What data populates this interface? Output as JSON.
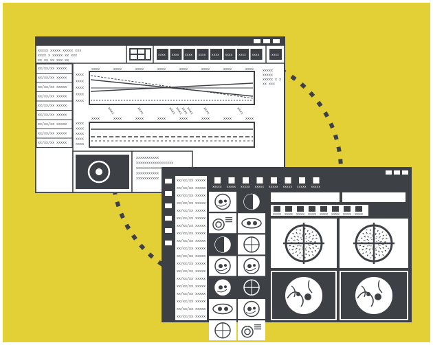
{
  "colors": {
    "background": "#e3cf36",
    "ink": "#3d4145",
    "paper": "#ffffff"
  },
  "icons": [
    "window-control-icons",
    "grid-layout-icon",
    "circle-scan-icon",
    "target-scan-icon",
    "brain-scan-icon",
    "spine-scan-icon",
    "document-icon"
  ],
  "window_back": {
    "header_text": [
      "xxxxx xxxxx   xxxxx xxx",
      "xxxx x xxxxx  xx   xxx",
      "xx  xx  xx      xxx  xx"
    ],
    "toolbar_tabs": [
      "xxxx",
      "xxxx",
      "xxxx",
      "xxxx",
      "xxxx",
      "xxxx",
      "xxxx",
      "xxxx"
    ],
    "toolbar_right": "xxxx",
    "list_items": [
      "xx/xx/xx xxxxx",
      "xx/xx/xx xxxxx",
      "xx/xx/xx xxxxx",
      "xx/xx/xx xxxxx",
      "xx/xx/xx xxxxx",
      "xx/xx/xx xxxxx",
      "xx/xx/xx xxxxx",
      "xx/xx/xx xxxxx",
      "xx/xx/xx xxxxx"
    ],
    "chart1": {
      "top_labels": [
        "xxxx",
        "xxxx",
        "xxxx",
        "xxxx",
        "xxxx",
        "xxxx",
        "xxxx",
        "xxxx"
      ],
      "left_labels": [
        "xxxx",
        "xxxx",
        "xxxx",
        "xxxx",
        "xxxx"
      ],
      "bottom_labels": [
        "xxxx",
        "xxxx",
        "xxxx",
        "xxxx",
        "xxxx",
        "xxxx",
        "xxxx",
        "xxxx"
      ],
      "rotated_labels": [
        "xxxx",
        "xxxx",
        "xxxx",
        "xxxx",
        "xxxx",
        "xxxx",
        "xxxx",
        "xxxx"
      ]
    },
    "chart2": {
      "left_labels": [
        "xxxx",
        "xxxx",
        "xxxx",
        "xxxx",
        "xxxx"
      ]
    },
    "side_note": [
      "xxxxx",
      "xxxxx",
      "xxxxx x x",
      "xx xxx"
    ],
    "text_block": [
      "xxxxxxxxxxx",
      "xxxxxxxxxxxxxxxxxx",
      "xxxxxxxxxxxxxxxxx",
      "xxxxxxxxxxx",
      "xxxxxxxxxxx"
    ]
  },
  "window_front": {
    "top_labels": [
      "xxxxx",
      "xxxxx",
      "xxxxx",
      "xxxxx",
      "xxxxx",
      "xxxxx",
      "xxxxx",
      "xxxxx"
    ],
    "list_items": [
      "xx/xx/xx xxxxx",
      "xx/xx/xx xxxxx",
      "xx/xx/xx xxxxx",
      "xx/xx/xx xxxxx",
      "xx/xx/xx xxxxx",
      "xx/xx/xx xxxxx",
      "xx/xx/xx xxxxx",
      "xx/xx/xx xxxxx",
      "xx/xx/xx xxxxx",
      "xx/xx/xx xxxxx",
      "xx/xx/xx xxxxx",
      "xx/xx/xx xxxxx",
      "xx/xx/xx xxxxx",
      "xx/xx/xx xxxxx",
      "xx/xx/xx xxxxx",
      "xx/xx/xx xxxxx",
      "xx/xx/xx xxxxx",
      "xx/xx/xx xxxxx",
      "xx/xx/xx xxxxx"
    ],
    "small_labels": [
      "xxxx",
      "xxxx",
      "xxxx",
      "xxxx",
      "xxxx",
      "xxxx",
      "xxxx",
      "xxxx"
    ],
    "side_labels": [
      "xxxx",
      "xxxx",
      "xxxx",
      "xxxx",
      "xxxx",
      "xxxx",
      "xxxx",
      "xxxx"
    ]
  }
}
